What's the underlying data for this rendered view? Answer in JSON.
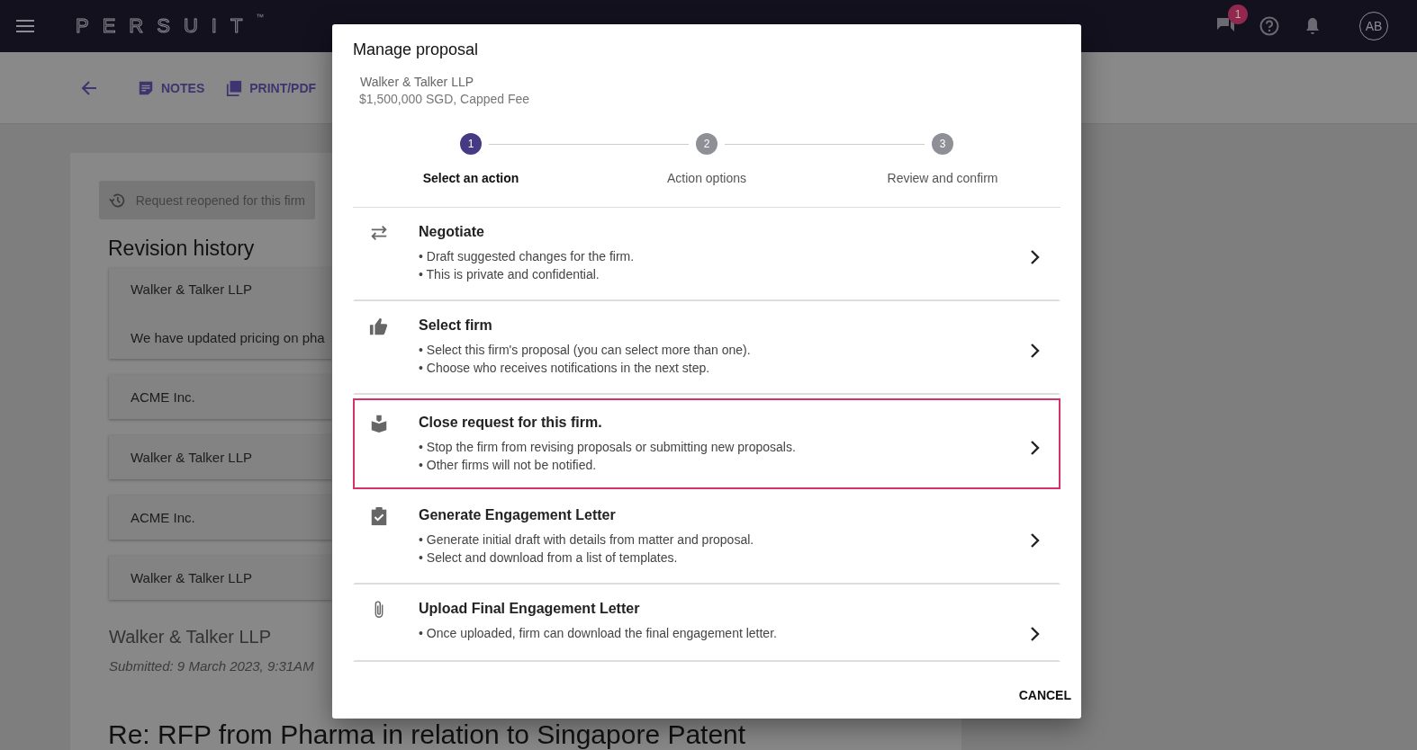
{
  "topbar": {
    "logo": "PERSUIT",
    "trademark": "™",
    "badge": "1",
    "avatar": "AB"
  },
  "toolbar": {
    "buttons": [
      {
        "kind": "notes",
        "label": "NOTES"
      },
      {
        "kind": "pdf",
        "label": "PRINT/PDF"
      }
    ]
  },
  "page": {
    "status": "Request reopened for this firm",
    "heading": "Revision history",
    "revisions": [
      {
        "firm": "Walker & Talker LLP",
        "note": "We have updated pricing on pha"
      },
      {
        "firm": "ACME Inc."
      },
      {
        "firm": "Walker & Talker LLP"
      },
      {
        "firm": "ACME Inc."
      },
      {
        "firm": "Walker & Talker LLP"
      }
    ],
    "firm": "Walker & Talker LLP",
    "submitted": "Submitted: 9 March 2023, 9:31AM",
    "subject": "Re: RFP from Pharma in relation to Singapore Patent"
  },
  "modal": {
    "title": "Manage proposal",
    "firm": "Walker & Talker LLP",
    "fee": "$1,500,000 SGD, Capped Fee",
    "steps": [
      {
        "number": "1",
        "label": "Select an action",
        "selected": true
      },
      {
        "number": "2",
        "label": "Action options",
        "selected": false
      },
      {
        "number": "3",
        "label": "Review and confirm",
        "selected": false
      }
    ],
    "actions": [
      {
        "kind": "swap",
        "title": "Negotiate",
        "bullets": [
          "• Draft suggested changes for the firm.",
          "• This is private and confidential."
        ],
        "selected": false
      },
      {
        "kind": "thumb",
        "title": "Select firm",
        "bullets": [
          "• Select this firm's proposal (you can select more than one).",
          "• Choose who receives notifications in the next step."
        ],
        "selected": false
      },
      {
        "kind": "box",
        "title": "Close request for this firm.",
        "bullets": [
          "• Stop the firm from revising proposals or submitting new proposals.",
          "• Other firms will not be notified."
        ],
        "selected": true
      },
      {
        "kind": "clipboard",
        "title": "Generate Engagement Letter",
        "bullets": [
          "• Generate initial draft with details from matter and proposal.",
          "• Select and download from a list of templates."
        ],
        "selected": false
      },
      {
        "kind": "clip",
        "title": "Upload Final Engagement Letter",
        "bullets": [
          "• Once uploaded, firm can download the final engagement letter."
        ],
        "selected": false
      }
    ],
    "cancel": "CANCEL"
  }
}
